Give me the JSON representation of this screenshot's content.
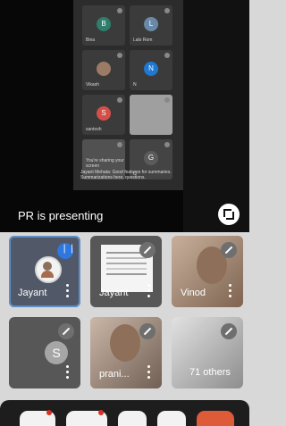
{
  "presentation": {
    "presenting_text": "PR is presenting",
    "caption_text": "Jayant Mehata: Good features for summaries. Summarizations here, questions.",
    "participants": [
      {
        "label": "Bina",
        "initial": "B",
        "color": "#2f7d6b"
      },
      {
        "label": "Lalo Rom",
        "initial": "L",
        "color": "#6a89a8"
      },
      {
        "label": "Vikash",
        "initial": "",
        "color": "#9b7a66"
      },
      {
        "label": "N",
        "initial": "N",
        "color": "#1f78d1"
      },
      {
        "label": "santosh",
        "initial": "S",
        "color": "#d34f48"
      },
      {
        "label": "",
        "initial": "",
        "color": "#8e8e8e"
      },
      {
        "label": "You're sharing your screen",
        "initial": "",
        "color": "#666666"
      },
      {
        "label": "G",
        "initial": "G",
        "color": "#5b5b5b"
      }
    ]
  },
  "tiles": [
    {
      "name": "Jayant",
      "kind": "avatar",
      "active": true
    },
    {
      "name": "Jayant",
      "kind": "doc",
      "active": false
    },
    {
      "name": "Vinod",
      "kind": "video",
      "active": false
    },
    {
      "name": "",
      "kind": "initial",
      "initial": "S",
      "active": false
    },
    {
      "name": "prani...",
      "kind": "video",
      "active": false
    },
    {
      "name": "71 others",
      "kind": "others",
      "active": false
    }
  ],
  "colors": {
    "stage": "#070707",
    "accent": "#2f76df",
    "active_outline": "#5e8ec9",
    "tile": "#575757"
  }
}
